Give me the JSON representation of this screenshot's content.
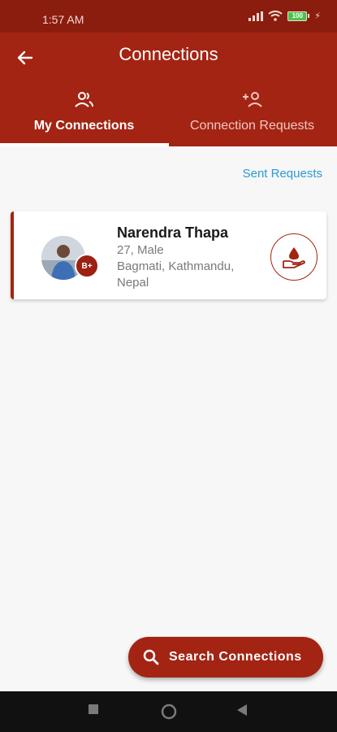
{
  "status_bar": {
    "time": "1:57 AM",
    "battery": "100"
  },
  "header": {
    "title": "Connections"
  },
  "tabs": [
    {
      "label": "My Connections",
      "icon": "people-icon",
      "active": true
    },
    {
      "label": "Connection Requests",
      "icon": "person-add-icon",
      "active": false
    }
  ],
  "sent_requests_label": "Sent Requests",
  "connections": [
    {
      "name": "Narendra Thapa",
      "age_gender": "27, Male",
      "location": "Bagmati, Kathmandu, Nepal",
      "blood_group": "B+"
    }
  ],
  "fab": {
    "label": "Search Connections",
    "icon": "search-icon"
  },
  "colors": {
    "primary": "#a32413",
    "status": "#8b1d0f",
    "link": "#2b9ad8"
  }
}
